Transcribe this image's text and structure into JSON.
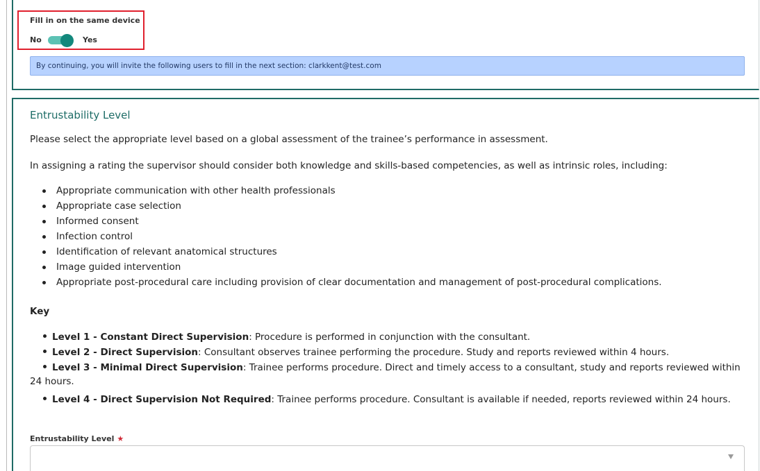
{
  "device_section": {
    "toggle_label": "Fill in on the same device",
    "toggle_off_label": "No",
    "toggle_on_label": "Yes",
    "toggle_state": "on",
    "invite_notice": "By continuing, you will invite the following users to fill in the next section: clarkkent@test.com"
  },
  "entrustability": {
    "title": "Entrustability Level",
    "intro": "Please select the appropriate level based on a global assessment of the trainee’s performance in assessment.",
    "criteria_intro": "In assigning a rating the supervisor should consider both knowledge and skills-based competencies, as well as intrinsic roles, including:",
    "criteria": [
      "Appropriate communication with other health professionals",
      "Appropriate case selection",
      "Informed consent",
      "Infection control",
      "Identification of relevant anatomical structures",
      "Image guided intervention",
      "Appropriate post-procedural care including provision of clear documentation and management of post-procedural complications."
    ],
    "key_heading": "Key",
    "key_levels": [
      {
        "name": "Level 1 - Constant Direct Supervision",
        "description": ": Procedure is performed in conjunction with the consultant."
      },
      {
        "name": "Level 2 - Direct Supervision",
        "description": ": Consultant observes trainee performing the procedure. Study and reports reviewed within 4 hours."
      },
      {
        "name": "Level 3 - Minimal Direct Supervision",
        "description": ": Trainee performs procedure. Direct and timely access to a consultant, study and reports reviewed within 24 hours."
      },
      {
        "name": "Level 4 - Direct Supervision Not Required",
        "description": ": Trainee performs procedure. Consultant is available if needed, reports reviewed within 24 hours."
      }
    ],
    "field_label": "Entrustability Level",
    "required_marker": "★",
    "select_value": ""
  },
  "colors": {
    "accent_teal": "#1f6b66",
    "toggle_on": "#13887c",
    "notice_bg": "#b7d2ff",
    "highlight_red": "#e0202d",
    "required_red": "#d02a36"
  },
  "icons": {
    "dropdown": "chevron-down-icon",
    "required": "star-icon"
  }
}
